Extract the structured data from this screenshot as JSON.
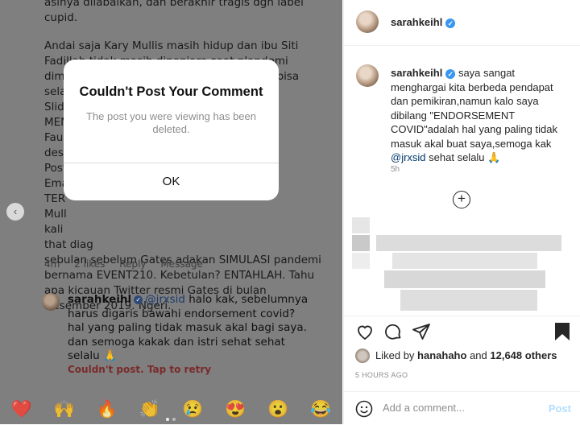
{
  "left_panel": {
    "comment_top": "asinya dilabaikan, dan berakhir tragis dgn label cupid.",
    "comment_body": "Andai saja Kary Mullis masih hidup dan ibu Siti Fadillah tidak masih dipenjara saat plandemi dimulai, bayangkan berapa juta nyawa yg bisa selar\nSlide\nMEN\nFauc\ndesa                                                     ton\nPost\nEma                                                      FB\nTER\nMull\nkali\nthat diag\nsebulan sebelum Gates adakan SIMULASI pandemi bernama EVENT210. Kebetulan? ENTAHLAH. Tahu apa kicauan Twitter resmi Gates di bulan Desember 2019. Ngeri.",
    "meta": {
      "time": "4m",
      "likes": "2 likes",
      "reply": "Reply",
      "message": "Message"
    },
    "reply": {
      "username": "sarahkeihl",
      "mention": "@jrxsid",
      "text": " halo kak, sebelumnya harus digaris bawahi endorsement covid? hal yang paling tidak masuk akal bagi saya. dan semoga kakak dan istri sehat sehat selalu 🙏"
    },
    "failed_text": "Couldn't post. Tap to retry",
    "emojis": [
      "❤️",
      "🙌",
      "🔥",
      "👏",
      "😢",
      "😍",
      "😮",
      "😂"
    ]
  },
  "dialog": {
    "title": "Couldn't Post Your Comment",
    "message": "The post you were viewing has been deleted.",
    "ok_label": "OK"
  },
  "right_panel": {
    "header_username": "sarahkeihl",
    "caption": {
      "username": "sarahkeihl",
      "text_before": " saya sangat menghargai kita berbeda pendapat dan pemikiran,namun kalo saya dibilang \"ENDORSEMENT COVID\"adalah hal yang paling tidak masuk akal buat saya,semoga kak ",
      "mention": "@jrxsid",
      "text_after": " sehat selalu 🙏",
      "time": "5h"
    },
    "load_more_icon": "plus-circle-icon",
    "likes": {
      "prefix": "Liked by ",
      "user": "hanahaho",
      "middle": " and ",
      "others": "12,648 others"
    },
    "posted_time": "5 HOURS AGO",
    "comment_placeholder": "Add a comment...",
    "post_label": "Post"
  },
  "colors": {
    "accent": "#3897f0",
    "post_disabled": "#b2dffc",
    "overlay": "#7f7f7f"
  }
}
